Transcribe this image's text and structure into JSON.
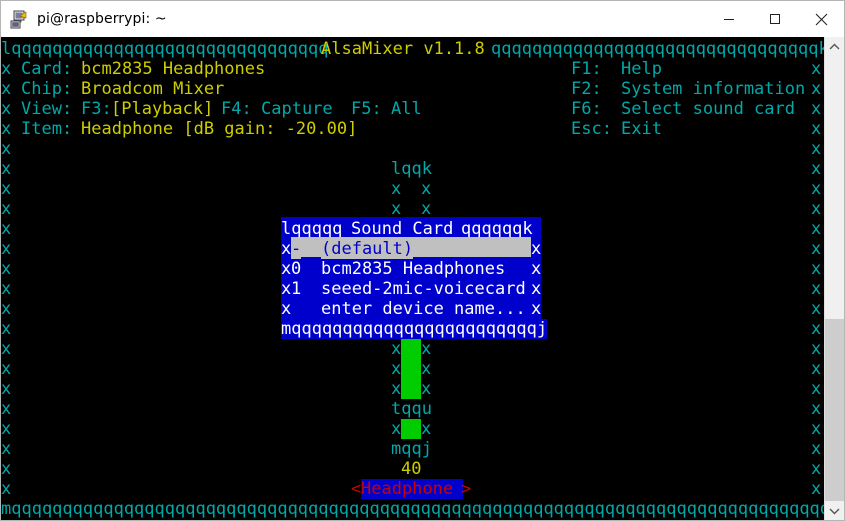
{
  "window": {
    "title": "pi@raspberrypi: ~",
    "icon": "terminal-icon",
    "minimize_label": "—",
    "maximize_label": "□",
    "close_label": "✕"
  },
  "terminal": {
    "app_title": "AlsaMixer",
    "app_version": "v1.1.8",
    "header": {
      "card_label": "Card:",
      "card_value": "bcm2835 Headphones",
      "chip_label": "Chip:",
      "chip_value": "Broadcom Mixer",
      "view_label": "View:",
      "view_value": "F3:[Playback] F4: Capture  F5: All",
      "item_label": "Item:",
      "item_value": "Headphone [dB gain: -20.00]"
    },
    "keys": [
      {
        "key": "F1:",
        "label": "Help"
      },
      {
        "key": "F2:",
        "label": "System information"
      },
      {
        "key": "F6:",
        "label": "Select sound card"
      },
      {
        "key": "Esc:",
        "label": "Exit"
      }
    ],
    "border": {
      "top_left": "l",
      "top_right": "k",
      "bottom_left": "m",
      "bottom_right": "j",
      "horizontal": "q",
      "vertical": "x",
      "tee_up": "t",
      "tee_right": "u"
    },
    "meter": {
      "cap_top": "lqqk",
      "left_edge": "x",
      "right_edge": "x",
      "fill_char": "a",
      "bar_char": "O",
      "mid_left": "t",
      "mid_mid": "qq",
      "mid_right": "u",
      "foot": "mqqj",
      "value": "40",
      "label": "Headphone ",
      "left_arrow": "<",
      "right_arrow": ">"
    },
    "dialog": {
      "title": "Sound Card",
      "title_left": "lqqqqq",
      "title_right": "qqqqqqk",
      "bottom": "mqqqqqqqqqqqqqqqqqqqqqqqj",
      "rows": [
        {
          "index": "-",
          "label": "(default)",
          "selected": true
        },
        {
          "index": "0",
          "label": "bcm2835 Headphones",
          "selected": false
        },
        {
          "index": "1",
          "label": "seeed-2mic-voicecard",
          "selected": false
        },
        {
          "index": " ",
          "label": "enter device name...",
          "selected": false
        }
      ]
    }
  },
  "scrollbar": {
    "up_arrow": "scroll-up-icon",
    "down_arrow": "scroll-down-icon"
  },
  "colors": {
    "cyan": "#00a8a8",
    "yellow": "#cdcd00",
    "white": "#d0d0d0",
    "green": "#00cd00",
    "blue": "#0000cc",
    "red": "#cd0000",
    "silver": "#c0c0c0"
  }
}
